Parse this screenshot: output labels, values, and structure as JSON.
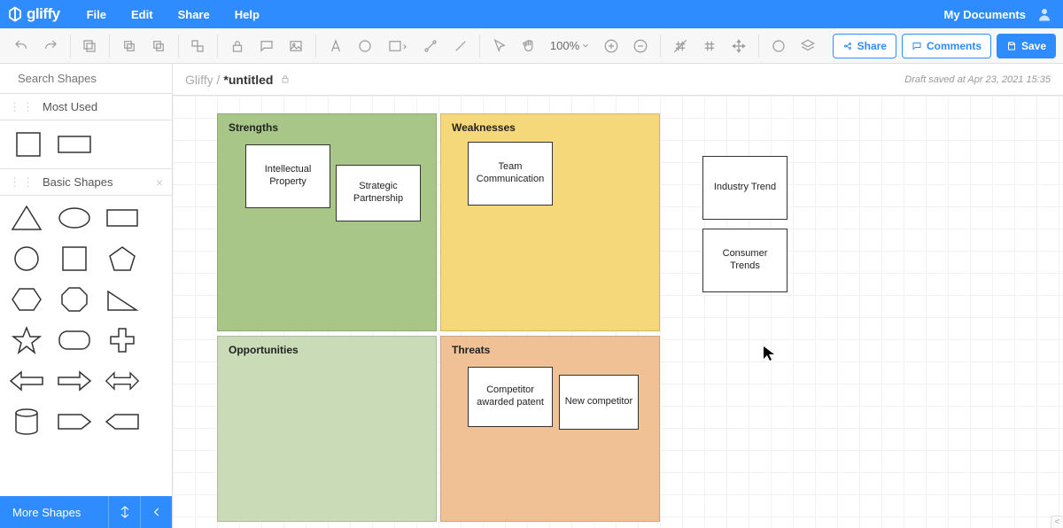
{
  "brand": "gliffy",
  "menu": {
    "file": "File",
    "edit": "Edit",
    "share": "Share",
    "help": "Help",
    "mydocs": "My Documents"
  },
  "toolbar": {
    "zoom": "100%",
    "share": "Share",
    "comments": "Comments",
    "save": "Save"
  },
  "sidebar": {
    "search_placeholder": "Search Shapes",
    "most_used": "Most Used",
    "basic_shapes": "Basic Shapes",
    "more_shapes": "More Shapes"
  },
  "doc": {
    "crumb": "Gliffy /",
    "title": "*untitled",
    "draft": "Draft saved at Apr 23, 2021 15:35"
  },
  "swot": {
    "strengths": "Strengths",
    "weaknesses": "Weaknesses",
    "opportunities": "Opportunities",
    "threats": "Threats"
  },
  "cards": {
    "ip": "Intellectual Property",
    "sp": "Strategic Partnership",
    "tc": "Team Communication",
    "cap": "Competitor awarded patent",
    "nc": "New competitor",
    "it": "Industry Trend",
    "ct": "Consumer Trends"
  }
}
